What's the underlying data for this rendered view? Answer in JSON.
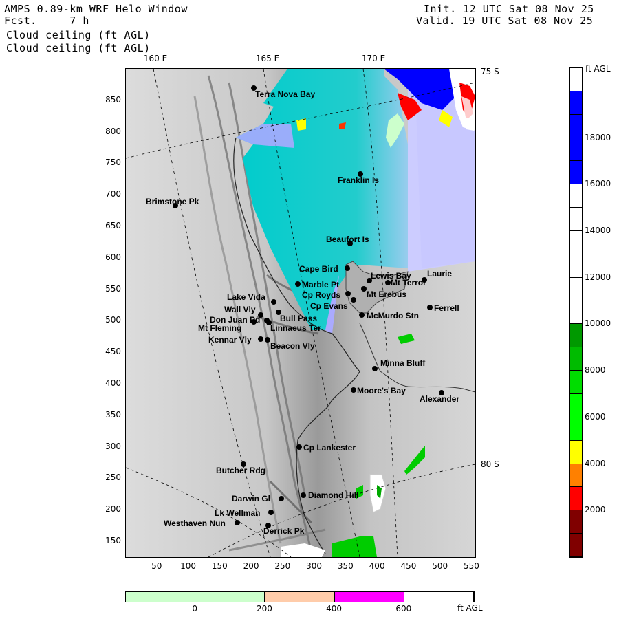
{
  "header": {
    "title": "AMPS 0.89-km WRF Helo Window",
    "fcst": "Fcst.     7 h",
    "field1": "Cloud ceiling (ft AGL)",
    "field2": "Cloud ceiling (ft AGL)",
    "init": "Init. 12 UTC Sat 08 Nov 25",
    "valid": "Valid. 19 UTC Sat 08 Nov 25"
  },
  "axes": {
    "x_ticks": [
      "50",
      "100",
      "150",
      "200",
      "250",
      "300",
      "350",
      "400",
      "450",
      "500",
      "550"
    ],
    "y_ticks": [
      "850",
      "800",
      "750",
      "700",
      "650",
      "600",
      "550",
      "500",
      "450",
      "400",
      "350",
      "300",
      "250",
      "200",
      "150"
    ],
    "xlim": [
      0,
      555
    ],
    "ylim": [
      125,
      900
    ]
  },
  "graticule_labels": {
    "lon": [
      "160 E",
      "165 E",
      "170 E"
    ],
    "lat": [
      "75 S",
      "80 S"
    ]
  },
  "places": [
    {
      "name": "Terra Nova Bay"
    },
    {
      "name": "Franklin Is"
    },
    {
      "name": "Brimstone Pk"
    },
    {
      "name": "Beaufort Is"
    },
    {
      "name": "Cape Bird"
    },
    {
      "name": "Lewis Bay"
    },
    {
      "name": "Laurie"
    },
    {
      "name": "Mt Terror"
    },
    {
      "name": "Marble Pt"
    },
    {
      "name": "Cp Royds"
    },
    {
      "name": "Mt Erebus"
    },
    {
      "name": "Lake Vida"
    },
    {
      "name": "Cp Evans"
    },
    {
      "name": "Ferrell"
    },
    {
      "name": "Wall Vly"
    },
    {
      "name": "Bull Pass"
    },
    {
      "name": "McMurdo Stn"
    },
    {
      "name": "Don Juan Pd"
    },
    {
      "name": "Mt Fleming"
    },
    {
      "name": "Linnaeus Ter"
    },
    {
      "name": "Kennar Vly"
    },
    {
      "name": "Beacon Vly"
    },
    {
      "name": "Minna Bluff"
    },
    {
      "name": "Moore's Bay"
    },
    {
      "name": "Alexander"
    },
    {
      "name": "Cp Lankester"
    },
    {
      "name": "Butcher Rdg"
    },
    {
      "name": "Diamond Hill"
    },
    {
      "name": "Darwin Gl"
    },
    {
      "name": "Lk Wellman"
    },
    {
      "name": "Westhaven Nun"
    },
    {
      "name": "Derrick Pk"
    }
  ],
  "colorbar_vertical": {
    "unit": "ft AGL",
    "ticks": [
      "18000",
      "16000",
      "14000",
      "12000",
      "10000",
      "8000",
      "6000",
      "4000",
      "2000"
    ],
    "colors": [
      "#ffffff",
      "#0000ff",
      "#0000ff",
      "#0000ff",
      "#0000ff",
      "#ffffff",
      "#ffffff",
      "#ffffff",
      "#ffffff",
      "#ffffff",
      "#ffffff",
      "#009900",
      "#00bb00",
      "#00dd00",
      "#00ff00",
      "#00ff00",
      "#ffff00",
      "#ff8000",
      "#ff0000",
      "#800000",
      "#800000"
    ]
  },
  "colorbar_horizontal": {
    "unit": "ft AGL",
    "ticks": [
      "0",
      "200",
      "400",
      "600"
    ],
    "colors": [
      "#ccffcc",
      "#ccffcc",
      "#ffccaa",
      "#ff00ff",
      "#ffffff"
    ]
  },
  "colors": {
    "sea_ice_cyan": "#00cccc",
    "light_blue": "#aaaaff",
    "lavender": "#ccccff",
    "land_gray": "#d4d4d4"
  }
}
